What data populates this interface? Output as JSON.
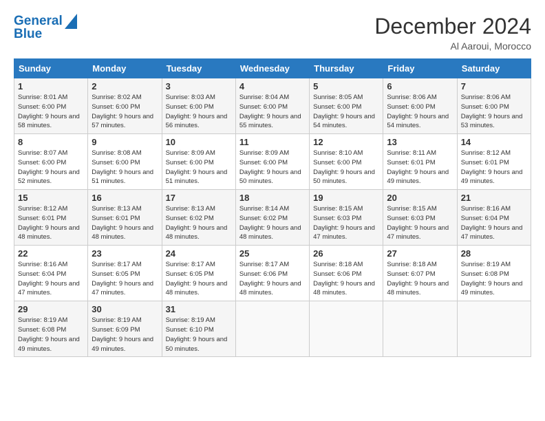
{
  "logo": {
    "line1": "General",
    "line2": "Blue"
  },
  "title": {
    "month_year": "December 2024",
    "location": "Al Aaroui, Morocco"
  },
  "headers": [
    "Sunday",
    "Monday",
    "Tuesday",
    "Wednesday",
    "Thursday",
    "Friday",
    "Saturday"
  ],
  "weeks": [
    [
      {
        "day": "1",
        "sunrise": "8:01 AM",
        "sunset": "6:00 PM",
        "daylight": "9 hours and 58 minutes."
      },
      {
        "day": "2",
        "sunrise": "8:02 AM",
        "sunset": "6:00 PM",
        "daylight": "9 hours and 57 minutes."
      },
      {
        "day": "3",
        "sunrise": "8:03 AM",
        "sunset": "6:00 PM",
        "daylight": "9 hours and 56 minutes."
      },
      {
        "day": "4",
        "sunrise": "8:04 AM",
        "sunset": "6:00 PM",
        "daylight": "9 hours and 55 minutes."
      },
      {
        "day": "5",
        "sunrise": "8:05 AM",
        "sunset": "6:00 PM",
        "daylight": "9 hours and 54 minutes."
      },
      {
        "day": "6",
        "sunrise": "8:06 AM",
        "sunset": "6:00 PM",
        "daylight": "9 hours and 54 minutes."
      },
      {
        "day": "7",
        "sunrise": "8:06 AM",
        "sunset": "6:00 PM",
        "daylight": "9 hours and 53 minutes."
      }
    ],
    [
      {
        "day": "8",
        "sunrise": "8:07 AM",
        "sunset": "6:00 PM",
        "daylight": "9 hours and 52 minutes."
      },
      {
        "day": "9",
        "sunrise": "8:08 AM",
        "sunset": "6:00 PM",
        "daylight": "9 hours and 51 minutes."
      },
      {
        "day": "10",
        "sunrise": "8:09 AM",
        "sunset": "6:00 PM",
        "daylight": "9 hours and 51 minutes."
      },
      {
        "day": "11",
        "sunrise": "8:09 AM",
        "sunset": "6:00 PM",
        "daylight": "9 hours and 50 minutes."
      },
      {
        "day": "12",
        "sunrise": "8:10 AM",
        "sunset": "6:00 PM",
        "daylight": "9 hours and 50 minutes."
      },
      {
        "day": "13",
        "sunrise": "8:11 AM",
        "sunset": "6:01 PM",
        "daylight": "9 hours and 49 minutes."
      },
      {
        "day": "14",
        "sunrise": "8:12 AM",
        "sunset": "6:01 PM",
        "daylight": "9 hours and 49 minutes."
      }
    ],
    [
      {
        "day": "15",
        "sunrise": "8:12 AM",
        "sunset": "6:01 PM",
        "daylight": "9 hours and 48 minutes."
      },
      {
        "day": "16",
        "sunrise": "8:13 AM",
        "sunset": "6:01 PM",
        "daylight": "9 hours and 48 minutes."
      },
      {
        "day": "17",
        "sunrise": "8:13 AM",
        "sunset": "6:02 PM",
        "daylight": "9 hours and 48 minutes."
      },
      {
        "day": "18",
        "sunrise": "8:14 AM",
        "sunset": "6:02 PM",
        "daylight": "9 hours and 48 minutes."
      },
      {
        "day": "19",
        "sunrise": "8:15 AM",
        "sunset": "6:03 PM",
        "daylight": "9 hours and 47 minutes."
      },
      {
        "day": "20",
        "sunrise": "8:15 AM",
        "sunset": "6:03 PM",
        "daylight": "9 hours and 47 minutes."
      },
      {
        "day": "21",
        "sunrise": "8:16 AM",
        "sunset": "6:04 PM",
        "daylight": "9 hours and 47 minutes."
      }
    ],
    [
      {
        "day": "22",
        "sunrise": "8:16 AM",
        "sunset": "6:04 PM",
        "daylight": "9 hours and 47 minutes."
      },
      {
        "day": "23",
        "sunrise": "8:17 AM",
        "sunset": "6:05 PM",
        "daylight": "9 hours and 47 minutes."
      },
      {
        "day": "24",
        "sunrise": "8:17 AM",
        "sunset": "6:05 PM",
        "daylight": "9 hours and 48 minutes."
      },
      {
        "day": "25",
        "sunrise": "8:17 AM",
        "sunset": "6:06 PM",
        "daylight": "9 hours and 48 minutes."
      },
      {
        "day": "26",
        "sunrise": "8:18 AM",
        "sunset": "6:06 PM",
        "daylight": "9 hours and 48 minutes."
      },
      {
        "day": "27",
        "sunrise": "8:18 AM",
        "sunset": "6:07 PM",
        "daylight": "9 hours and 48 minutes."
      },
      {
        "day": "28",
        "sunrise": "8:19 AM",
        "sunset": "6:08 PM",
        "daylight": "9 hours and 49 minutes."
      }
    ],
    [
      {
        "day": "29",
        "sunrise": "8:19 AM",
        "sunset": "6:08 PM",
        "daylight": "9 hours and 49 minutes."
      },
      {
        "day": "30",
        "sunrise": "8:19 AM",
        "sunset": "6:09 PM",
        "daylight": "9 hours and 49 minutes."
      },
      {
        "day": "31",
        "sunrise": "8:19 AM",
        "sunset": "6:10 PM",
        "daylight": "9 hours and 50 minutes."
      },
      null,
      null,
      null,
      null
    ]
  ],
  "labels": {
    "sunrise": "Sunrise:",
    "sunset": "Sunset:",
    "daylight": "Daylight:"
  }
}
